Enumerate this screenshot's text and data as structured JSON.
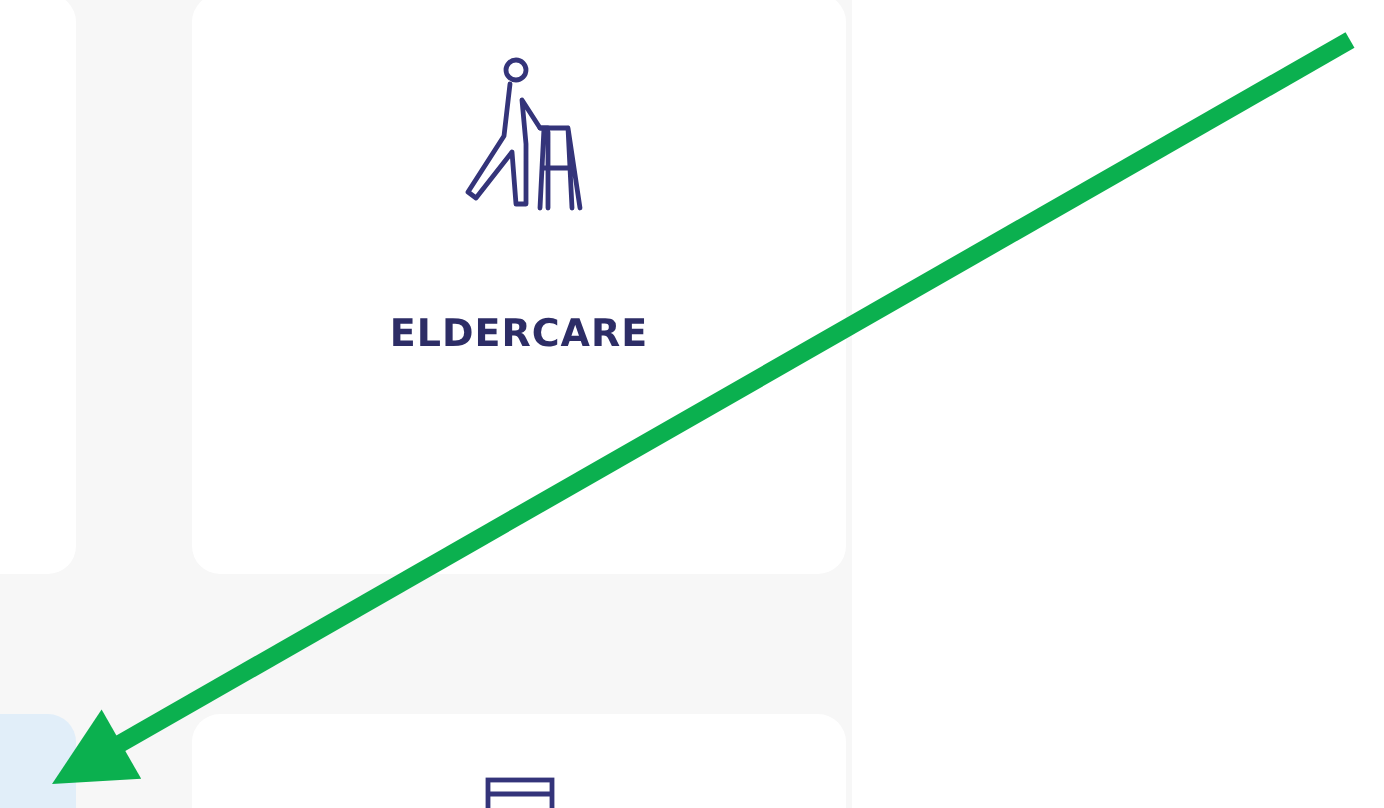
{
  "cards": [
    {
      "selected": false
    },
    {
      "label": "ELDERCARE",
      "selected": false
    },
    {
      "selected": true
    },
    {
      "selected": false
    }
  ]
}
